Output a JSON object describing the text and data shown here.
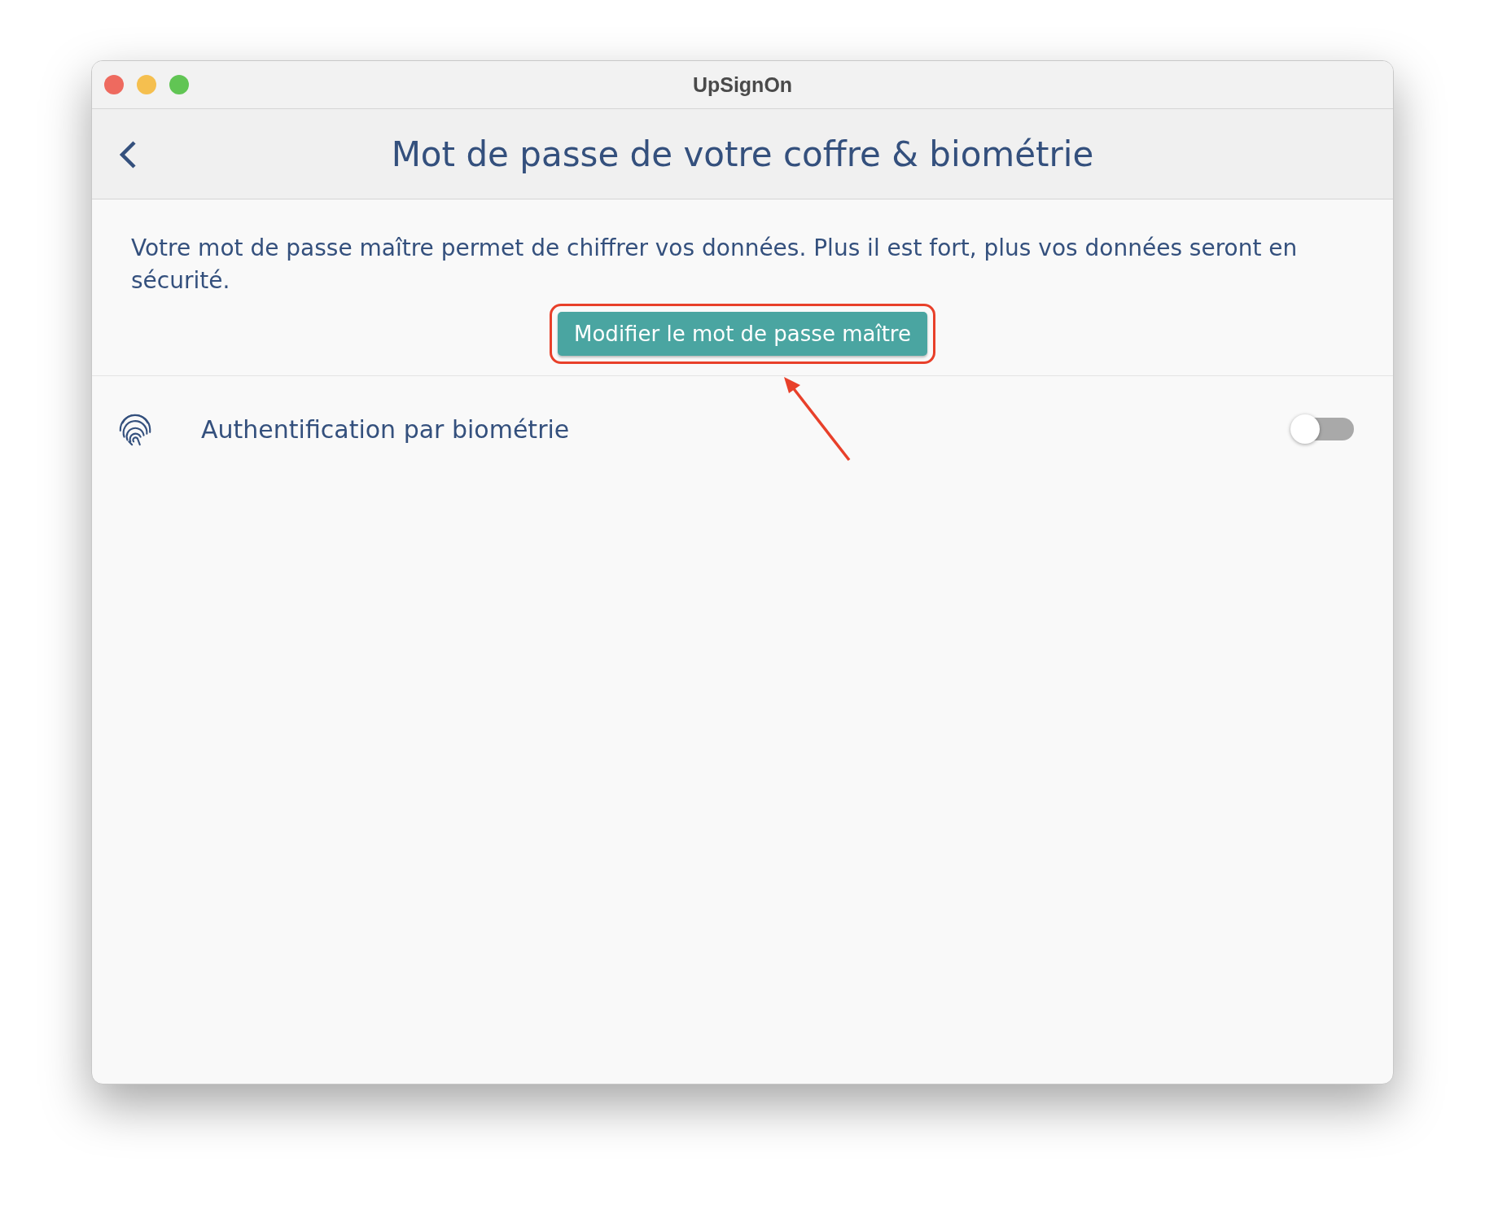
{
  "window": {
    "title": "UpSignOn"
  },
  "header": {
    "title": "Mot de passe de votre coffre & biométrie"
  },
  "description": "Votre mot de passe maître permet de chiffrer vos données. Plus il est fort, plus vos données seront en sécurité.",
  "primary_button": {
    "label": "Modifier le mot de passe maître"
  },
  "settings": [
    {
      "label": "Authentification par biométrie",
      "on": false
    }
  ]
}
